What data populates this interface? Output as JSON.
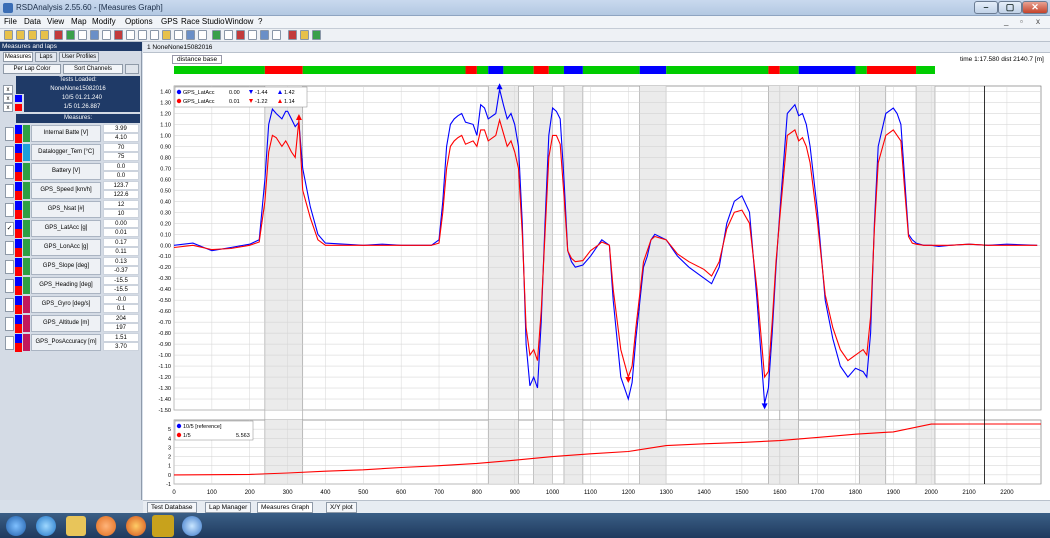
{
  "window": {
    "title": "RSDAnalysis 2.55.60 - [Measures Graph]",
    "minimize": "–",
    "maximize": "▢",
    "close": "✕"
  },
  "menu": [
    "File",
    "Data",
    "View",
    "Map",
    "Modify",
    "Options",
    "GPS",
    "Race Studio",
    "Window",
    "?"
  ],
  "mdi_controls": [
    "_",
    "▫",
    "x"
  ],
  "toolbar": {
    "icons": [
      "open-icon",
      "save-icon",
      "print-icon",
      "copy-icon",
      "graph-icon",
      "histogram-icon",
      "layout-icon",
      "color-icon",
      "grid-icon",
      "table-icon",
      "zoom-icon",
      "track-icon",
      "settings-icon",
      "laptimes-icon",
      "report-icon",
      "export-icon",
      "help-icon"
    ]
  },
  "left_panel": {
    "title": "Measures and laps",
    "tabs": [
      "Measures",
      "Laps",
      "User Profiles"
    ],
    "buttons": [
      "Per Lap Color",
      "Sort Channels"
    ],
    "tests_loaded_label": "Tests Loaded:",
    "tests": [
      {
        "name": "NoneNone15082016",
        "color": "#000000"
      },
      {
        "name": "10/5 01.21.240",
        "color": "#0000ff"
      },
      {
        "name": "1/5 01.26.887",
        "color": "#ff0000"
      }
    ],
    "measures_label": "Measures:",
    "measures": [
      {
        "name": "Internal Batte",
        "unit": "[V]",
        "v1": "3.99",
        "v2": "4.10",
        "checked": false,
        "color": "#2ea043"
      },
      {
        "name": "Datalogger_Tem",
        "unit": "[°C]",
        "v1": "70",
        "v2": "75",
        "checked": false,
        "color": "#1e9fd9"
      },
      {
        "name": "Battery",
        "unit": "[V]",
        "v1": "0.0",
        "v2": "0.0",
        "checked": false,
        "color": "#2ea043"
      },
      {
        "name": "GPS_Speed",
        "unit": "[km/h]",
        "v1": "123.7",
        "v2": "122.6",
        "checked": false,
        "color": "#2ea043"
      },
      {
        "name": "GPS_Nsat",
        "unit": "[#]",
        "v1": "12",
        "v2": "10",
        "checked": false,
        "color": "#2ea043"
      },
      {
        "name": "GPS_LatAcc",
        "unit": "[g]",
        "v1": "0.00",
        "v2": "0.01",
        "checked": true,
        "color": "#2ea043"
      },
      {
        "name": "GPS_LonAcc",
        "unit": "[g]",
        "v1": "0.17",
        "v2": "0.11",
        "checked": false,
        "color": "#2ea043"
      },
      {
        "name": "GPS_Slope",
        "unit": "[deg]",
        "v1": "0.13",
        "v2": "-0.37",
        "checked": false,
        "color": "#2ea043"
      },
      {
        "name": "GPS_Heading",
        "unit": "[deg]",
        "v1": "-15.5",
        "v2": "-15.5",
        "checked": false,
        "color": "#2ea043"
      },
      {
        "name": "GPS_Gyro",
        "unit": "[deg/s]",
        "v1": "-0.0",
        "v2": "0.1",
        "checked": false,
        "color": "#c2185b"
      },
      {
        "name": "GPS_Altitude",
        "unit": "[m]",
        "v1": "204",
        "v2": "197",
        "checked": false,
        "color": "#c2185b"
      },
      {
        "name": "GPS_PosAccuracy",
        "unit": "[m]",
        "v1": "1.51",
        "v2": "3.70",
        "checked": false,
        "color": "#c2185b"
      }
    ]
  },
  "main": {
    "session_tab": "1  NoneNone15082016",
    "distance_base": "distance base",
    "readout": "time 1:17.580   dist 2140.7 [m]",
    "legend": [
      {
        "name": "GPS_LatAcc",
        "value": "0.00",
        "min": "-1.44",
        "max": "1.42",
        "color": "#0000ff"
      },
      {
        "name": "GPS_LatAcc",
        "value": "0.01",
        "min": "-1.22",
        "max": "1.14",
        "color": "#ff0000"
      }
    ],
    "bottom_legend": [
      {
        "name": "10/5 [reference]",
        "value": "",
        "color": "#0000ff"
      },
      {
        "name": "1/5",
        "value": "5.563",
        "color": "#ff0000"
      }
    ]
  },
  "status_tabs": [
    "Test Database",
    "Lap Manager",
    "Measures Graph",
    "X/Y plot"
  ],
  "chart_data": {
    "type": "line",
    "xlabel": "",
    "ylabel": "",
    "x_ticks": [
      0,
      100,
      200,
      300,
      400,
      500,
      600,
      700,
      800,
      900,
      1000,
      1100,
      1200,
      1300,
      1400,
      1500,
      1600,
      1700,
      1800,
      1900,
      2000,
      2100,
      2200
    ],
    "xlim": [
      0,
      2290
    ],
    "ylim": [
      -1.5,
      1.45
    ],
    "y_ticks": [
      "1.40",
      "1.30",
      "1.20",
      "1.10",
      "1.00",
      "0.90",
      "0.80",
      "0.70",
      "0.60",
      "0.50",
      "0.40",
      "0.30",
      "0.20",
      "0.10",
      "0.00",
      "-0.10",
      "-0.20",
      "-0.30",
      "-0.40",
      "-0.50",
      "-0.60",
      "-0.70",
      "-0.80",
      "-0.90",
      "-1.00",
      "-1.10",
      "-1.20",
      "-1.30",
      "-1.40",
      "-1.50"
    ],
    "grid": true,
    "cursor_x": 2140.7,
    "shaded_regions": [
      [
        240,
        340
      ],
      [
        830,
        910
      ],
      [
        950,
        1000
      ],
      [
        1030,
        1080
      ],
      [
        1230,
        1300
      ],
      [
        1570,
        1600
      ],
      [
        1600,
        1650
      ],
      [
        1810,
        1880
      ],
      [
        1960,
        2010
      ]
    ],
    "segment_colors": [
      "#00cc00",
      "#ff0000",
      "#00cc00",
      "#ff0000",
      "#00cc00",
      "#0000ff",
      "#00cc00",
      "#ff0000",
      "#00cc00",
      "#0000ff",
      "#00cc00",
      "#0000ff",
      "#00cc00",
      "#ff0000",
      "#00cc00",
      "#0000ff",
      "#00cc00",
      "#ff0000",
      "#00cc00"
    ],
    "segment_bounds": [
      0,
      240,
      340,
      770,
      800,
      830,
      870,
      950,
      990,
      1030,
      1080,
      1230,
      1300,
      1570,
      1600,
      1650,
      1800,
      1830,
      1960,
      2010,
      2290
    ],
    "series": [
      {
        "name": "10/5",
        "color": "#0000ff",
        "x": [
          0,
          50,
          100,
          150,
          200,
          225,
          240,
          250,
          260,
          270,
          285,
          295,
          300,
          310,
          320,
          330,
          340,
          360,
          380,
          400,
          450,
          500,
          550,
          600,
          650,
          680,
          700,
          710,
          720,
          730,
          740,
          750,
          760,
          770,
          790,
          800,
          810,
          820,
          830,
          850,
          860,
          870,
          880,
          890,
          900,
          910,
          920,
          930,
          940,
          950,
          960,
          970,
          980,
          990,
          1000,
          1010,
          1020,
          1030,
          1040,
          1050,
          1060,
          1080,
          1100,
          1120,
          1130,
          1150,
          1160,
          1180,
          1200,
          1210,
          1220,
          1240,
          1250,
          1260,
          1270,
          1300,
          1330,
          1360,
          1400,
          1420,
          1440,
          1460,
          1480,
          1500,
          1520,
          1540,
          1560,
          1570,
          1580,
          1590,
          1600,
          1620,
          1640,
          1650,
          1660,
          1670,
          1680,
          1700,
          1720,
          1740,
          1760,
          1780,
          1800,
          1820,
          1830,
          1840,
          1850,
          1860,
          1880,
          1900,
          1910,
          1920,
          1930,
          1940,
          1950,
          1960,
          1980,
          2000,
          2020,
          2050,
          2100,
          2150,
          2200,
          2280
        ],
        "y": [
          0.0,
          0.02,
          -0.05,
          -0.02,
          0.01,
          0.05,
          0.6,
          1.1,
          1.24,
          1.2,
          1.15,
          1.22,
          1.22,
          1.15,
          1.08,
          1.12,
          0.7,
          0.35,
          0.1,
          0.02,
          0.01,
          0.0,
          0.01,
          0.0,
          0.0,
          0.0,
          0.05,
          0.4,
          0.9,
          1.1,
          1.15,
          1.18,
          1.2,
          1.12,
          1.1,
          1.0,
          1.28,
          1.25,
          1.15,
          1.2,
          1.42,
          1.28,
          1.15,
          1.2,
          1.1,
          0.9,
          0.2,
          -0.9,
          -1.28,
          -1.2,
          -1.3,
          -0.7,
          0.2,
          1.0,
          1.25,
          1.22,
          1.15,
          0.6,
          -0.05,
          -0.15,
          -0.2,
          -0.18,
          -0.1,
          0.0,
          0.05,
          0.0,
          -0.5,
          -1.2,
          -1.4,
          -1.25,
          -0.85,
          -0.2,
          -0.1,
          0.05,
          0.1,
          0.05,
          -0.1,
          -0.2,
          -0.3,
          -0.35,
          -0.2,
          0.2,
          0.4,
          0.45,
          0.3,
          -0.5,
          -1.44,
          -1.3,
          -0.8,
          -0.2,
          0.3,
          1.2,
          1.28,
          1.18,
          1.2,
          1.1,
          0.9,
          0.3,
          -0.5,
          -0.85,
          -1.1,
          -1.2,
          -1.12,
          -1.15,
          -1.2,
          -0.8,
          0.2,
          0.9,
          1.2,
          1.25,
          1.2,
          1.1,
          0.6,
          0.1,
          0.05,
          0.02,
          0.0,
          0.0,
          -0.01,
          0.0,
          0.01,
          0.0,
          0.01,
          0.0
        ]
      },
      {
        "name": "1/5",
        "color": "#ff0000",
        "x": [
          0,
          50,
          100,
          150,
          200,
          225,
          240,
          250,
          260,
          270,
          285,
          295,
          300,
          310,
          320,
          330,
          340,
          360,
          380,
          400,
          450,
          500,
          550,
          600,
          650,
          680,
          700,
          710,
          720,
          730,
          740,
          750,
          760,
          770,
          790,
          800,
          810,
          820,
          830,
          850,
          860,
          870,
          880,
          890,
          900,
          910,
          920,
          930,
          940,
          950,
          960,
          970,
          980,
          990,
          1000,
          1010,
          1020,
          1030,
          1040,
          1050,
          1060,
          1080,
          1100,
          1120,
          1130,
          1150,
          1160,
          1180,
          1200,
          1210,
          1220,
          1240,
          1250,
          1260,
          1270,
          1300,
          1330,
          1360,
          1400,
          1420,
          1440,
          1460,
          1480,
          1500,
          1520,
          1540,
          1560,
          1570,
          1580,
          1590,
          1600,
          1620,
          1640,
          1650,
          1660,
          1670,
          1680,
          1700,
          1720,
          1740,
          1760,
          1780,
          1800,
          1820,
          1830,
          1840,
          1850,
          1860,
          1880,
          1900,
          1910,
          1920,
          1930,
          1940,
          1950,
          1960,
          1980,
          2000,
          2020,
          2050,
          2100,
          2150,
          2200,
          2280
        ],
        "y": [
          -0.02,
          0.0,
          -0.04,
          -0.03,
          0.0,
          0.03,
          0.4,
          0.85,
          1.0,
          0.98,
          0.9,
          0.95,
          0.92,
          0.85,
          0.8,
          1.14,
          0.5,
          0.25,
          0.05,
          0.0,
          0.0,
          0.0,
          0.0,
          0.0,
          0.0,
          0.0,
          0.02,
          0.3,
          0.7,
          0.9,
          0.95,
          0.98,
          1.0,
          0.92,
          0.95,
          0.9,
          1.05,
          1.05,
          0.95,
          1.0,
          1.14,
          1.02,
          0.9,
          0.95,
          0.85,
          0.7,
          0.1,
          -0.75,
          -1.0,
          -0.95,
          -1.05,
          -0.6,
          0.1,
          0.8,
          1.0,
          1.0,
          0.92,
          0.45,
          -0.05,
          -0.12,
          -0.15,
          -0.14,
          -0.05,
          0.0,
          0.03,
          0.0,
          -0.4,
          -0.95,
          -1.2,
          -1.1,
          -0.75,
          -0.15,
          -0.05,
          0.05,
          0.08,
          0.05,
          -0.08,
          -0.15,
          -0.22,
          -0.28,
          -0.15,
          0.15,
          0.3,
          0.32,
          0.2,
          -0.4,
          -1.2,
          -1.15,
          -0.7,
          -0.15,
          0.25,
          1.0,
          1.05,
          0.95,
          0.98,
          0.9,
          0.75,
          0.2,
          -0.45,
          -0.75,
          -0.95,
          -1.05,
          -1.0,
          -0.95,
          -1.0,
          -0.65,
          0.15,
          0.75,
          1.0,
          1.05,
          1.0,
          0.95,
          0.5,
          0.08,
          0.02,
          0.01,
          0.0,
          0.0,
          0.0,
          0.0,
          0.01,
          0.0,
          0.0,
          0.0
        ]
      }
    ],
    "bottom": {
      "ylim": [
        -1,
        6
      ],
      "y_ticks": [
        "5",
        "4",
        "3",
        "2",
        "1",
        "0",
        "-1"
      ],
      "series": {
        "name": "1/5",
        "color": "#ff0000",
        "x": [
          0,
          200,
          300,
          400,
          500,
          600,
          700,
          800,
          900,
          1000,
          1100,
          1200,
          1300,
          1400,
          1500,
          1600,
          1700,
          1800,
          1900,
          2000,
          2100,
          2290
        ],
        "y": [
          0.0,
          0.05,
          0.2,
          0.4,
          0.55,
          0.8,
          1.0,
          1.25,
          1.6,
          2.0,
          2.3,
          2.55,
          3.2,
          3.4,
          3.55,
          3.75,
          4.1,
          4.45,
          4.7,
          5.55,
          5.56,
          5.56
        ]
      }
    }
  }
}
